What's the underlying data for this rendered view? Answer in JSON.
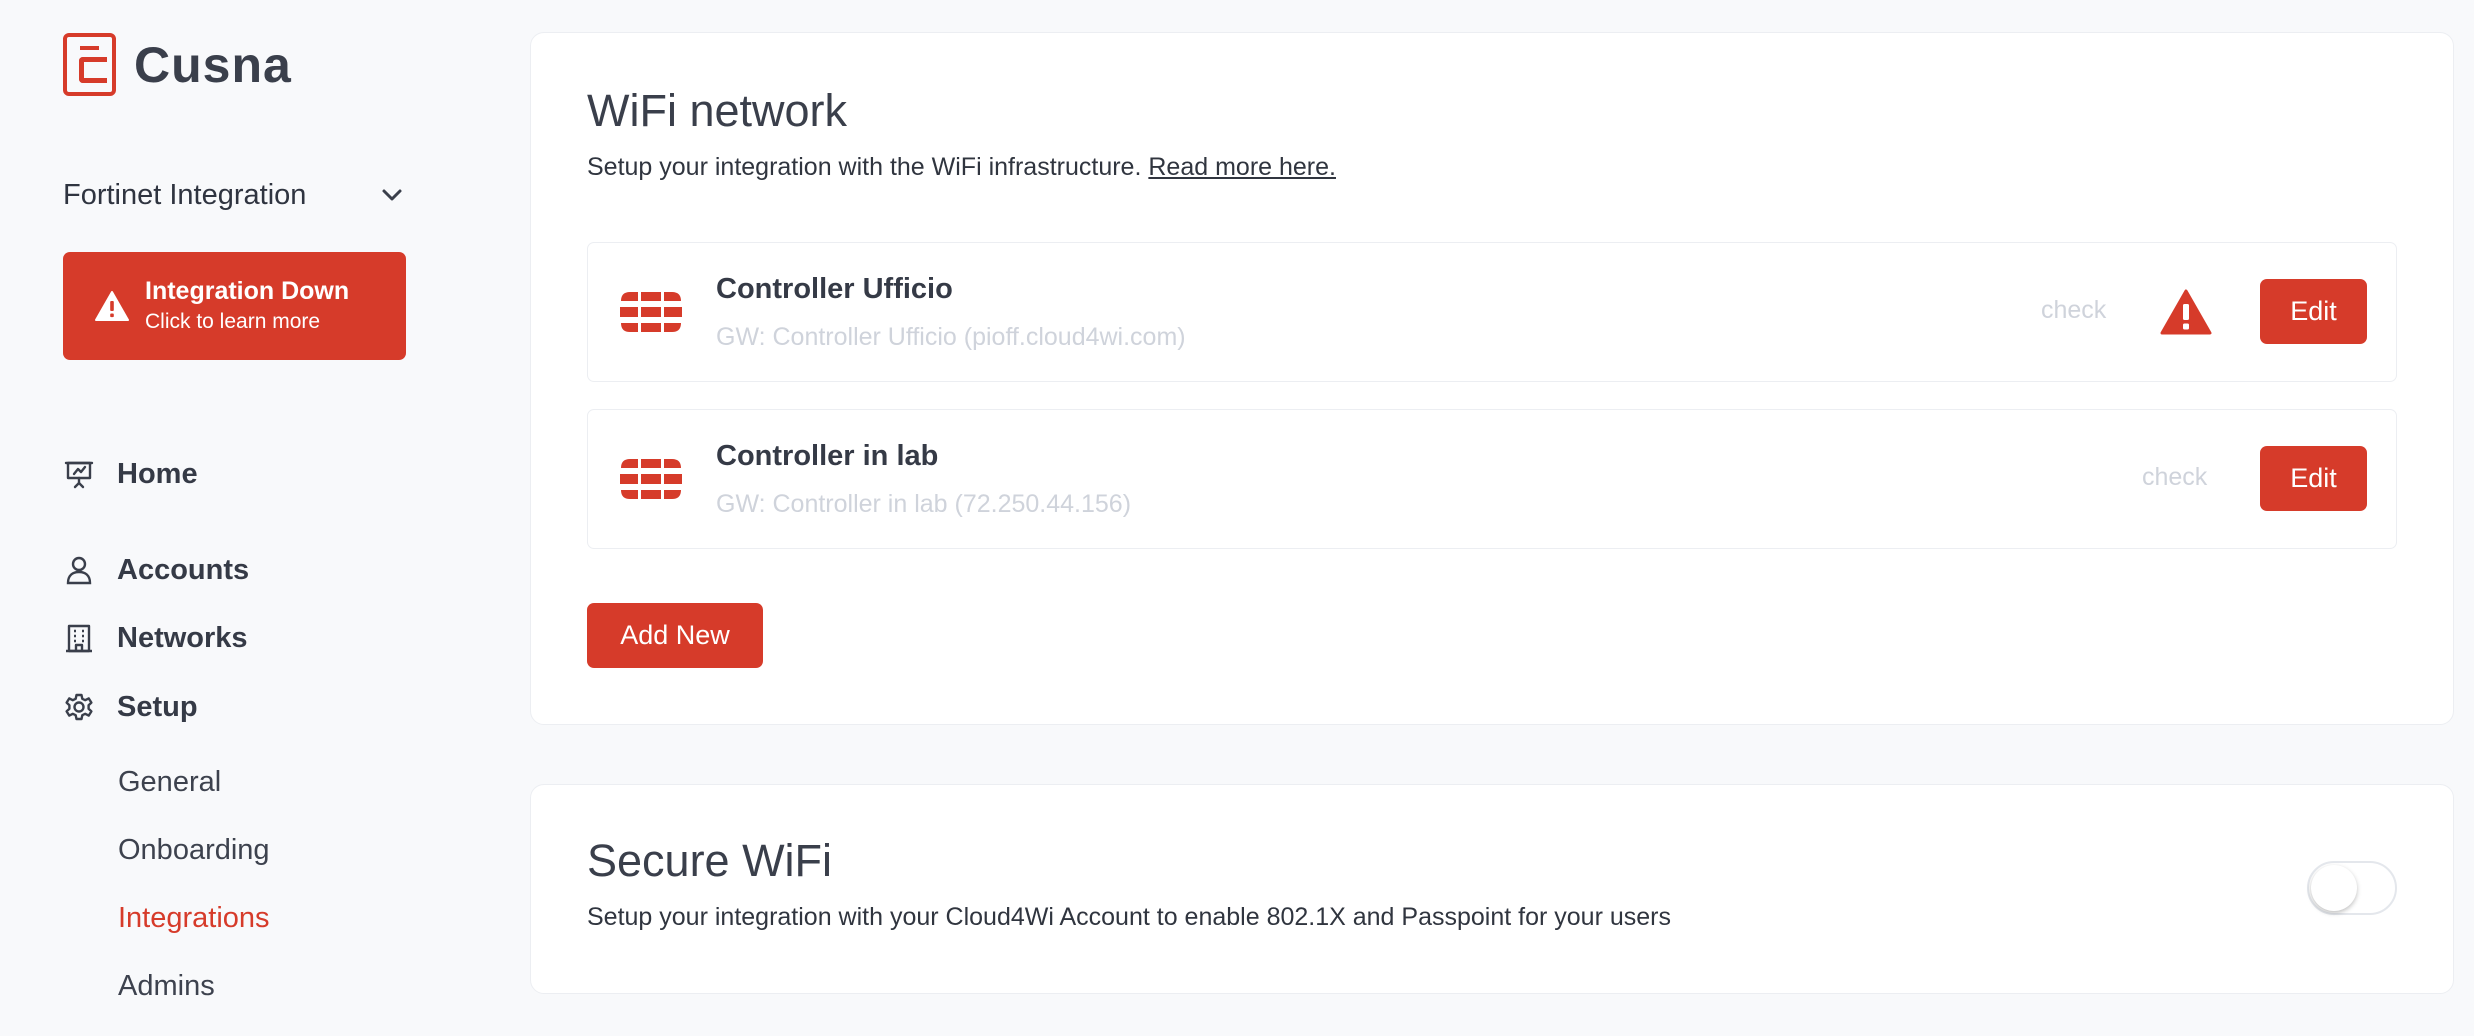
{
  "brand": {
    "name": "Cusna",
    "accent_color": "#d63b2a"
  },
  "org_select": {
    "label": "Fortinet Integration"
  },
  "alert": {
    "title": "Integration Down",
    "subtitle": "Click to learn more"
  },
  "nav": {
    "home": "Home",
    "accounts": "Accounts",
    "networks": "Networks",
    "setup": "Setup",
    "sub_items": [
      "General",
      "Onboarding",
      "Integrations",
      "Admins"
    ],
    "active_sub_item": "Integrations"
  },
  "wifi_card": {
    "title": "WiFi network",
    "description": "Setup your integration with the WiFi infrastructure.",
    "read_more": "Read more here.",
    "controllers": [
      {
        "name": "Controller Ufficio",
        "gateway": "GW: Controller Ufficio (pioff.cloud4wi.com)",
        "check_label": "check",
        "warning": true,
        "edit_label": "Edit"
      },
      {
        "name": "Controller in lab",
        "gateway": "GW: Controller in lab (72.250.44.156)",
        "check_label": "check",
        "warning": false,
        "edit_label": "Edit"
      }
    ],
    "add_new": "Add New"
  },
  "secure_card": {
    "title": "Secure WiFi",
    "description": "Setup your integration with your Cloud4Wi Account to enable 802.1X and Passpoint for your users",
    "toggle_on": false
  }
}
